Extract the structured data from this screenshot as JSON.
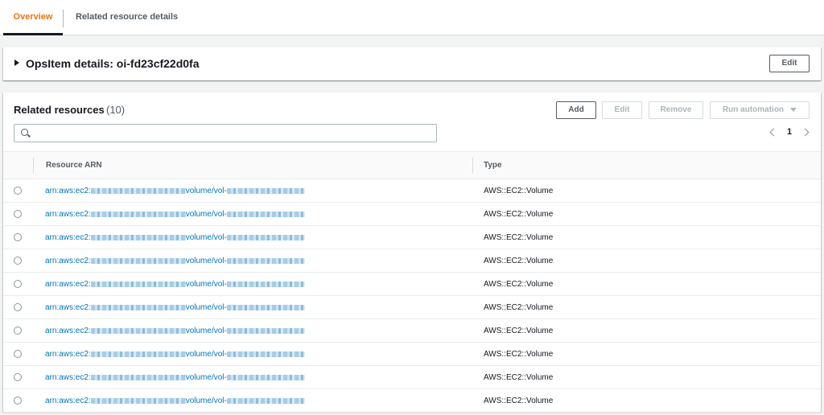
{
  "tabs": [
    {
      "label": "Overview",
      "active": true
    },
    {
      "label": "Related resource details",
      "active": false
    }
  ],
  "details": {
    "title": "OpsItem details: oi-fd23cf22d0fa",
    "edit_label": "Edit"
  },
  "resources": {
    "title": "Related resources",
    "count": "(10)",
    "add_label": "Add",
    "edit_label": "Edit",
    "remove_label": "Remove",
    "run_label": "Run automation",
    "search_placeholder": "",
    "page": "1",
    "columns": {
      "arn": "Resource ARN",
      "type": "Type"
    },
    "rows": [
      {
        "arn_prefix": "arn:aws:ec2:",
        "arn_mid": "volume/vol-",
        "type": "AWS::EC2::Volume"
      },
      {
        "arn_prefix": "arn:aws:ec2:",
        "arn_mid": "volume/vol-",
        "type": "AWS::EC2::Volume"
      },
      {
        "arn_prefix": "arn:aws:ec2:",
        "arn_mid": "volume/vol-",
        "type": "AWS::EC2::Volume"
      },
      {
        "arn_prefix": "arn:aws:ec2:",
        "arn_mid": "volume/vol-",
        "type": "AWS::EC2::Volume"
      },
      {
        "arn_prefix": "arn:aws:ec2:",
        "arn_mid": "volume/vol-",
        "type": "AWS::EC2::Volume"
      },
      {
        "arn_prefix": "arn:aws:ec2:",
        "arn_mid": "volume/vol-",
        "type": "AWS::EC2::Volume"
      },
      {
        "arn_prefix": "arn:aws:ec2:",
        "arn_mid": "volume/vol-",
        "type": "AWS::EC2::Volume"
      },
      {
        "arn_prefix": "arn:aws:ec2:",
        "arn_mid": "volume/vol-",
        "type": "AWS::EC2::Volume"
      },
      {
        "arn_prefix": "arn:aws:ec2:",
        "arn_mid": "volume/vol-",
        "type": "AWS::EC2::Volume"
      },
      {
        "arn_prefix": "arn:aws:ec2:",
        "arn_mid": "volume/vol-",
        "type": "AWS::EC2::Volume"
      }
    ]
  },
  "colors": {
    "accent": "#ec7211",
    "link": "#0073bb"
  },
  "icons": {
    "search": "search-icon",
    "expand": "caret-right-icon",
    "prev": "chevron-left-icon",
    "next": "chevron-right-icon",
    "dropdown": "caret-down-icon"
  }
}
